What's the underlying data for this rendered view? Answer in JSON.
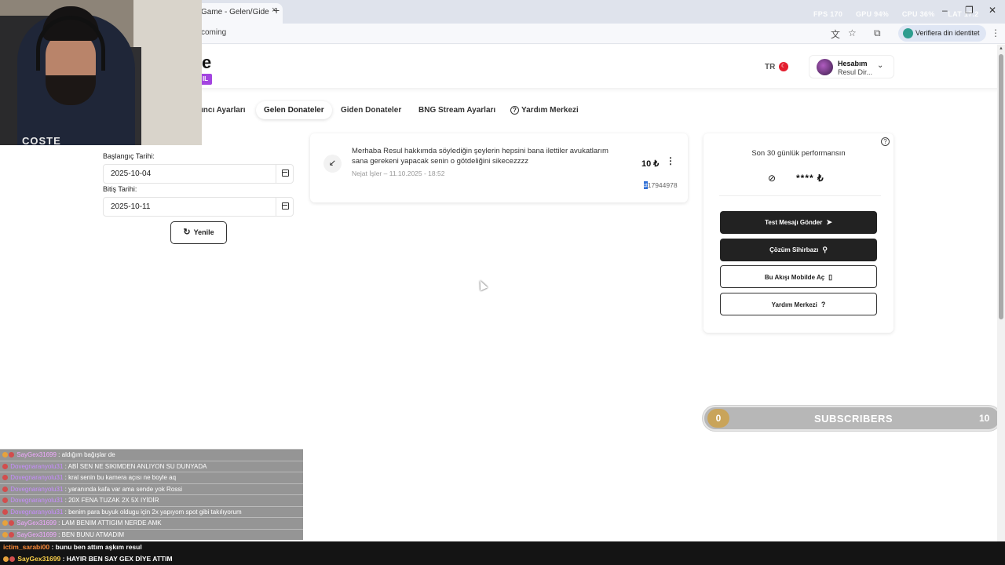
{
  "browser": {
    "tab_title": "Game - Gelen/Gide",
    "tab_close": "×",
    "new_tab": "+",
    "url": "coming",
    "stats": [
      "FPS 170",
      "GPU 94%",
      "CPU 36%",
      "LAT 17.2"
    ],
    "verify_label": "Verifiera din identitet",
    "window_controls": {
      "minimize": "–",
      "restore": "❐",
      "close": "✕"
    },
    "menu": "⋮"
  },
  "header": {
    "logo_letter": "e",
    "logo_tag": "IL",
    "language": "TR",
    "flag": "☾",
    "account_title": "Hesabım",
    "account_name": "Resul Dir...",
    "chevron": "⌄"
  },
  "nav": {
    "tabs": [
      {
        "label": "ıncı Ayarları",
        "active": false
      },
      {
        "label": "Gelen Donateler",
        "active": true
      },
      {
        "label": "Giden Donateler",
        "active": false
      },
      {
        "label": "BNG Stream Ayarları",
        "active": false
      },
      {
        "label": "Yardım Merkezi",
        "active": false,
        "icon": "?"
      }
    ]
  },
  "filters": {
    "start_label": "Başlangıç Tarihi:",
    "start_value": "2025-10-04",
    "end_label": "Bitiş Tarihi:",
    "end_value": "2025-10-11",
    "refresh_label": "Yenile",
    "refresh_icon": "↻"
  },
  "donation": {
    "arrow": "↙",
    "message": "Merhaba Resul hakkımda söylediğin şeylerin hepsini bana ilettiler avukatlarım sana gerekeni yapacak senin o götdeliğini sikecezzzz",
    "sender": "Nejat İşler",
    "date": "11.10.2025 - 18:52",
    "meta_sep": " – ",
    "amount": "10 ₺",
    "menu": "⋮",
    "id_highlight": "#",
    "id_rest": "17944978"
  },
  "performance": {
    "help": "?",
    "title": "Son 30 günlük performansın",
    "eye_icon": "⊘",
    "value": "**** ₺",
    "buttons": [
      {
        "label": "Test Mesajı Gönder",
        "icon": "➤",
        "style": "dark"
      },
      {
        "label": "Çözüm Sihirbazı",
        "icon": "⚲",
        "style": "dark"
      },
      {
        "label": "Bu Akışı Mobilde Aç",
        "icon": "▯",
        "style": "light"
      },
      {
        "label": "Yardım Merkezi",
        "icon": "?",
        "style": "light"
      }
    ]
  },
  "subscribers": {
    "current": "0",
    "label": "SUBSCRIBERS",
    "goal": "10"
  },
  "webcam": {
    "logo": "COSTE"
  },
  "chat": {
    "messages": [
      {
        "user": "SayGex31699",
        "text": ": aldığım bağışlar de"
      },
      {
        "user": "Dovegnaranyolu31",
        "text": ": ABİ SEN NE SIKIMDEN ANLIYON SU DUNYADA"
      },
      {
        "user": "Dovegnaranyolu31",
        "text": ": kral senin bu kamera açısı ne boyle aq"
      },
      {
        "user": "Dovegnaranyolu31",
        "text": ": yaranında kafa var ama sende yok Rossi"
      },
      {
        "user": "Dovegnaranyolu31",
        "text": ": 20X FENA TUZAK 2X 5X IYİDİR"
      },
      {
        "user": "Dovegnaranyolu31",
        "text": ": benim para buyuk oldugu için 2x yapıyom spot gibi takılıyorum"
      },
      {
        "user": "SayGex31699",
        "text": ": LAM BENIM ATTIGIM NERDE AMK"
      },
      {
        "user": "SayGex31699",
        "text": ": BEN BUNU ATMADIM"
      }
    ],
    "bottom": [
      {
        "user": "ictim_sarabi00",
        "text": ": bunu ben attım aşkım resul"
      },
      {
        "user": "SayGex31699",
        "text": ": HAYIR BEN SAY GEX DİYE ATTIM"
      }
    ]
  }
}
